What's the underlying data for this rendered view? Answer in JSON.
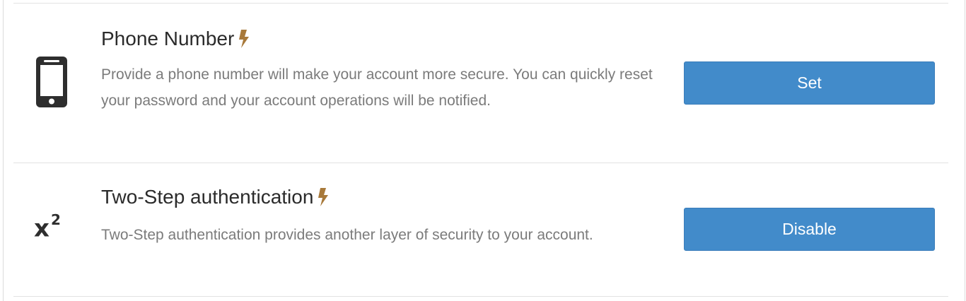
{
  "security_settings": {
    "items": [
      {
        "id": "phone-number",
        "icon": "smartphone-icon",
        "title": "Phone Number",
        "indicator_icon": "lightning-bolt-icon",
        "description": "Provide a phone number will make your account more secure. You can quickly reset your password and your account operations will be notified.",
        "button_label": "Set"
      },
      {
        "id": "two-step",
        "icon": "superscript-x2-icon",
        "icon_text": "x",
        "icon_sup": "2",
        "title": "Two-Step authentication",
        "indicator_icon": "lightning-bolt-icon",
        "description": "Two-Step authentication provides another layer of security to your account.",
        "button_label": "Disable"
      }
    ]
  },
  "colors": {
    "button_bg": "#428bca",
    "bolt": "#a8793a",
    "title": "#2b2b2b",
    "description": "#7b7b7b",
    "divider": "#e2e2e2"
  }
}
